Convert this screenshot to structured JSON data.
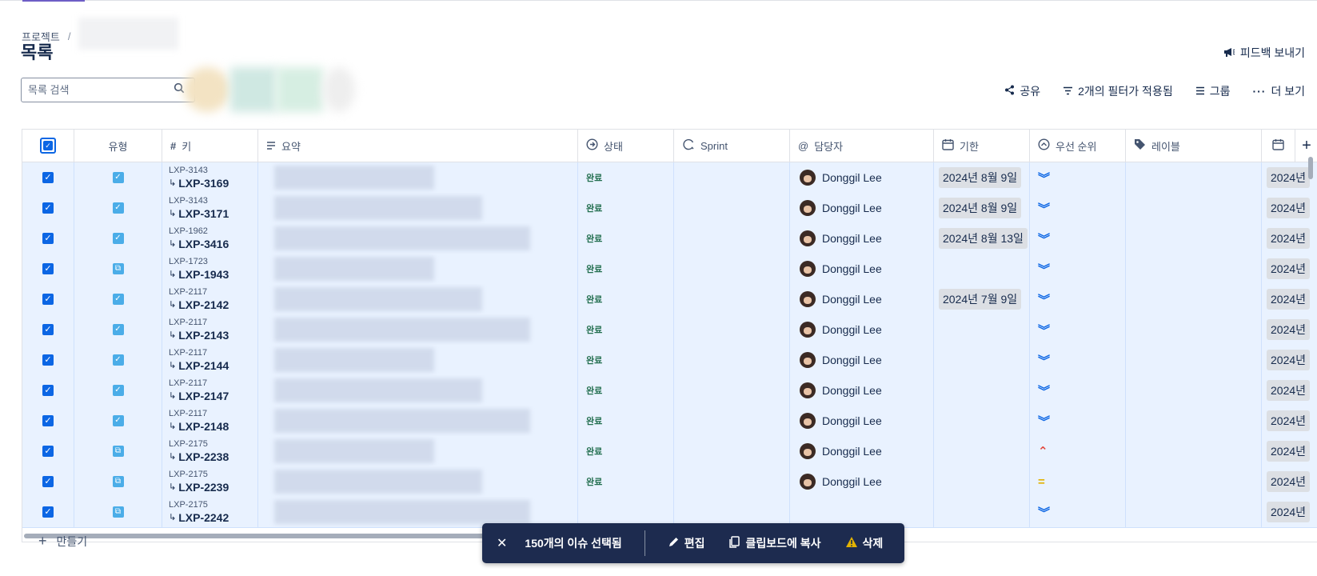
{
  "breadcrumb": {
    "root": "프로젝트",
    "separator": "/"
  },
  "page_title": "목록",
  "feedback_label": "피드백 보내기",
  "search": {
    "placeholder": "목록 검색"
  },
  "toolbar": {
    "share": "공유",
    "filter": "2개의 필터가 적용됨",
    "group": "그룹",
    "more": "더 보기"
  },
  "columns": {
    "type": "유형",
    "key": "키",
    "summary": "요약",
    "status": "상태",
    "sprint": "Sprint",
    "assignee": "담당자",
    "due": "기한",
    "priority": "우선 순위",
    "labels": "레이블"
  },
  "rows": [
    {
      "parent": "LXP-3143",
      "key": "LXP-3169",
      "type": "task",
      "status": "완료",
      "assignee": "Donggil Lee",
      "due": "2024년 8월 9일",
      "priority": "lowest",
      "extra": "2024년"
    },
    {
      "parent": "LXP-3143",
      "key": "LXP-3171",
      "type": "task",
      "status": "완료",
      "assignee": "Donggil Lee",
      "due": "2024년 8월 9일",
      "priority": "lowest",
      "extra": "2024년"
    },
    {
      "parent": "LXP-1962",
      "key": "LXP-3416",
      "type": "task",
      "status": "완료",
      "assignee": "Donggil Lee",
      "due": "2024년 8월 13일",
      "priority": "lowest",
      "extra": "2024년"
    },
    {
      "parent": "LXP-1723",
      "key": "LXP-1943",
      "type": "subtask",
      "status": "완료",
      "assignee": "Donggil Lee",
      "due": "",
      "priority": "lowest",
      "extra": "2024년"
    },
    {
      "parent": "LXP-2117",
      "key": "LXP-2142",
      "type": "task",
      "status": "완료",
      "assignee": "Donggil Lee",
      "due": "2024년 7월 9일",
      "priority": "lowest",
      "extra": "2024년"
    },
    {
      "parent": "LXP-2117",
      "key": "LXP-2143",
      "type": "task",
      "status": "완료",
      "assignee": "Donggil Lee",
      "due": "",
      "priority": "lowest",
      "extra": "2024년"
    },
    {
      "parent": "LXP-2117",
      "key": "LXP-2144",
      "type": "task",
      "status": "완료",
      "assignee": "Donggil Lee",
      "due": "",
      "priority": "lowest",
      "extra": "2024년"
    },
    {
      "parent": "LXP-2117",
      "key": "LXP-2147",
      "type": "task",
      "status": "완료",
      "assignee": "Donggil Lee",
      "due": "",
      "priority": "lowest",
      "extra": "2024년"
    },
    {
      "parent": "LXP-2117",
      "key": "LXP-2148",
      "type": "task",
      "status": "완료",
      "assignee": "Donggil Lee",
      "due": "",
      "priority": "lowest",
      "extra": "2024년"
    },
    {
      "parent": "LXP-2175",
      "key": "LXP-2238",
      "type": "subtask",
      "status": "완료",
      "assignee": "Donggil Lee",
      "due": "",
      "priority": "high",
      "extra": "2024년"
    },
    {
      "parent": "LXP-2175",
      "key": "LXP-2239",
      "type": "subtask",
      "status": "완료",
      "assignee": "Donggil Lee",
      "due": "",
      "priority": "medium",
      "extra": "2024년"
    },
    {
      "parent": "LXP-2175",
      "key": "LXP-2242",
      "type": "subtask",
      "status": "",
      "assignee": "",
      "due": "",
      "priority": "lowest",
      "extra": "2024년"
    }
  ],
  "create_label": "만들기",
  "actionbar": {
    "selected": "150개의 이슈 선택됨",
    "edit": "편집",
    "copy": "클립보드에 복사",
    "delete": "삭제"
  },
  "colors": {
    "accent": "#0c66e4",
    "row_selected": "#e9f2ff",
    "status_done": "#216e4e",
    "priority_low": "#0c66e4",
    "priority_high": "#e2483d",
    "priority_medium": "#e2b203"
  }
}
